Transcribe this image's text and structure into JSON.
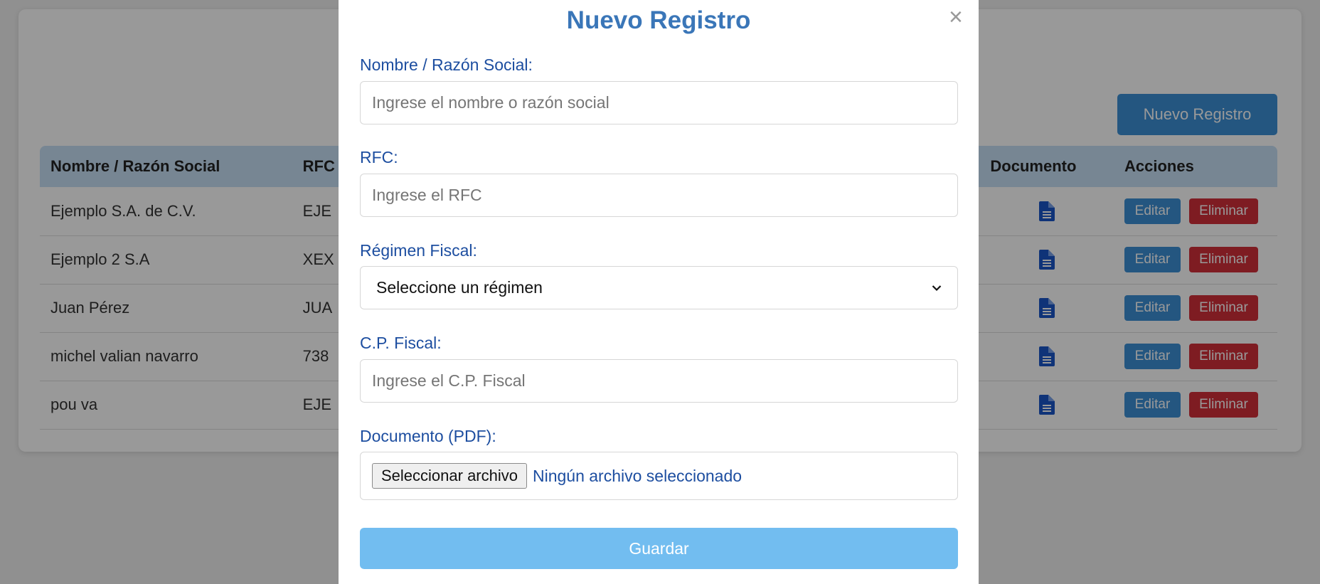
{
  "background": {
    "new_button_label": "Nuevo Registro",
    "table": {
      "headers": [
        "Nombre / Razón Social",
        "RFC",
        "Documento",
        "Acciones"
      ],
      "rows": [
        {
          "name": "Ejemplo S.A. de C.V.",
          "rfc": "EJE",
          "edit": "Editar",
          "delete": "Eliminar"
        },
        {
          "name": "Ejemplo 2 S.A",
          "rfc": "XEX",
          "edit": "Editar",
          "delete": "Eliminar"
        },
        {
          "name": "Juan Pérez",
          "rfc": "JUA",
          "edit": "Editar",
          "delete": "Eliminar"
        },
        {
          "name": "michel valian navarro",
          "rfc": "738",
          "edit": "Editar",
          "delete": "Eliminar"
        },
        {
          "name": "pou va",
          "rfc": "EJE",
          "edit": "Editar",
          "delete": "Eliminar"
        }
      ]
    }
  },
  "modal": {
    "title": "Nuevo Registro",
    "close_icon": "×",
    "fields": {
      "nombre": {
        "label": "Nombre / Razón Social:",
        "value": "",
        "placeholder": "Ingrese el nombre o razón social"
      },
      "rfc": {
        "label": "RFC:",
        "value": "",
        "placeholder": "Ingrese el RFC"
      },
      "regimen": {
        "label": "Régimen Fiscal:",
        "selected": "Seleccione un régimen"
      },
      "cp": {
        "label": "C.P. Fiscal:",
        "value": "",
        "placeholder": "Ingrese el C.P. Fiscal"
      },
      "documento": {
        "label": "Documento (PDF):",
        "button": "Seleccionar archivo",
        "status": "Ningún archivo seleccionado"
      }
    },
    "save_label": "Guardar"
  },
  "icons": {
    "document": "document-icon",
    "close": "close-icon",
    "chevron": "chevron-down-icon"
  },
  "colors": {
    "primary": "#3d8fd6",
    "danger": "#d32f3a",
    "title": "#3a76b8",
    "label": "#1d4ea0",
    "save": "#72bdf0"
  }
}
